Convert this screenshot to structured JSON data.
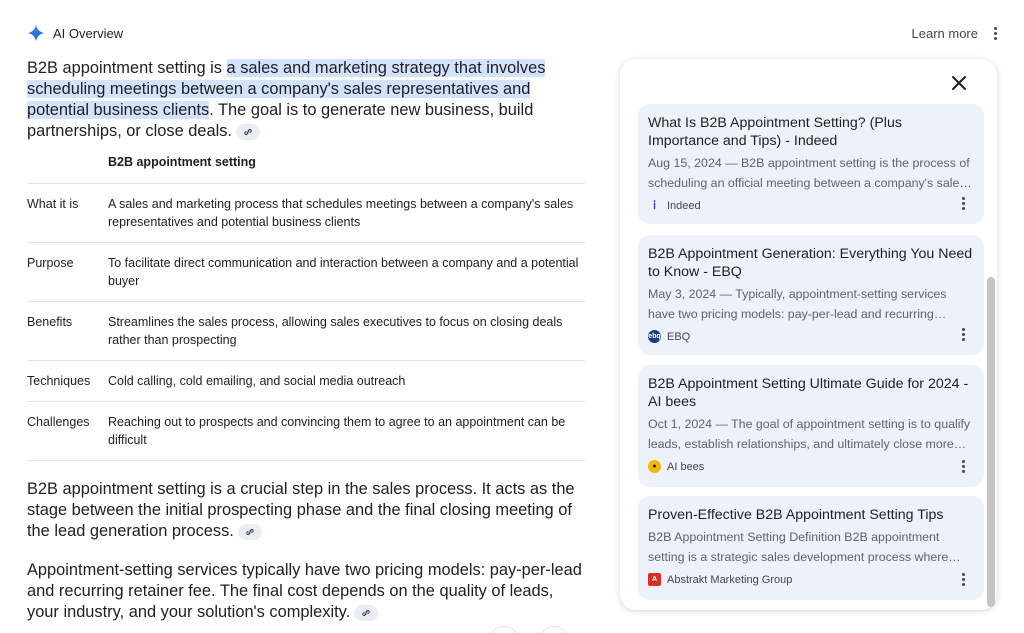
{
  "header": {
    "title": "AI Overview",
    "learn_more": "Learn more"
  },
  "intro": {
    "before": "B2B appointment setting is ",
    "highlight": "a sales and marketing strategy that involves scheduling meetings between a company's sales representatives and potential business clients",
    "after": ". The goal is to generate new business, build partnerships, or close deals."
  },
  "table": {
    "header": "B2B appointment setting",
    "rows": [
      {
        "label": "What it is",
        "value": "A sales and marketing process that schedules meetings between a company's sales representatives and potential business clients"
      },
      {
        "label": "Purpose",
        "value": "To facilitate direct communication and interaction between a company and a potential buyer"
      },
      {
        "label": "Benefits",
        "value": "Streamlines the sales process, allowing sales executives to focus on closing deals rather than prospecting"
      },
      {
        "label": "Techniques",
        "value": "Cold calling, cold emailing, and social media outreach"
      },
      {
        "label": "Challenges",
        "value": "Reaching out to prospects and convincing them to agree to an appointment can be difficult"
      }
    ]
  },
  "para2": "B2B appointment setting is a crucial step in the sales process. It acts as the stage between the initial prospecting phase and the final closing meeting of the lead generation process.",
  "para3": "Appointment-setting services typically have two pricing models: pay-per-lead and recurring retainer fee. The final cost depends on the quality of leads, your industry, and your solution's complexity.",
  "sources": [
    {
      "title": "What Is B2B Appointment Setting? (Plus Importance and Tips) - Indeed",
      "snippet": "Aug 15, 2024 — B2B appointment setting is the process of scheduling an official meeting between a company's sales team and a potential client.",
      "site": "Indeed",
      "icon": "indeed-icon",
      "color": "#2557a7"
    },
    {
      "title": "B2B Appointment Generation: Everything You Need to Know - EBQ",
      "snippet": "May 3, 2024 — Typically, appointment-setting services have two pricing models: pay-per-lead and recurring retainer fee.",
      "site": "EBQ",
      "icon": "ebq-icon",
      "color": "#1a3a8a"
    },
    {
      "title": "B2B Appointment Setting Ultimate Guide for 2024 - AI bees",
      "snippet": "Oct 1, 2024 — The goal of appointment setting is to qualify leads, establish relationships, and ultimately close more deals.",
      "site": "AI bees",
      "icon": "bee-icon",
      "color": "#f2b705"
    },
    {
      "title": "Proven-Effective B2B Appointment Setting Tips",
      "snippet": "B2B Appointment Setting Definition B2B appointment setting is a strategic sales development process where representatives book meetings.",
      "site": "Abstrakt Marketing Group",
      "icon": "abstrakt-icon",
      "color": "#d93025"
    }
  ]
}
